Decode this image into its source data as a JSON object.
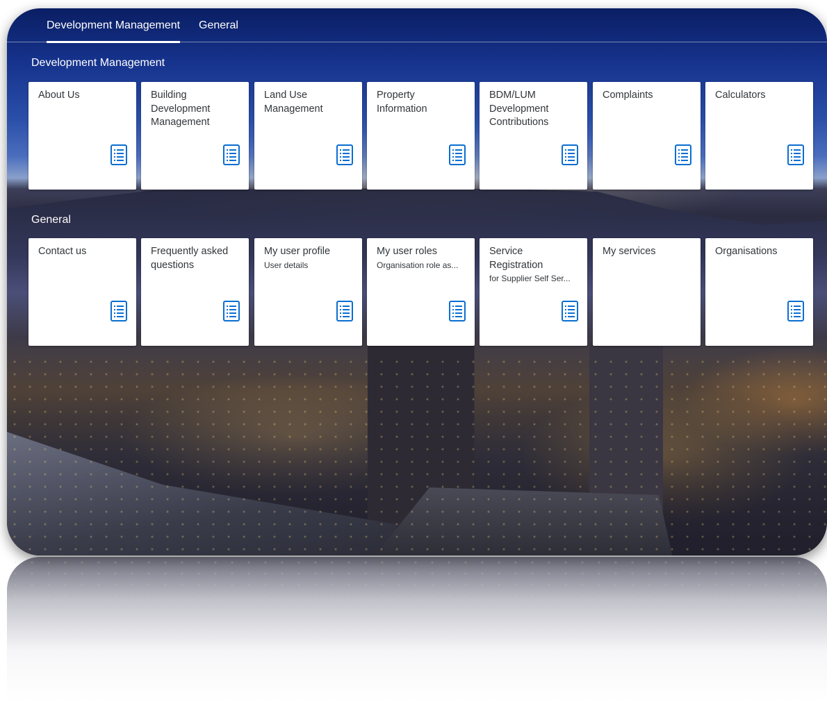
{
  "tabs": [
    {
      "label": "Development Management",
      "active": true
    },
    {
      "label": "General",
      "active": false
    }
  ],
  "sections": [
    {
      "title": "Development Management",
      "tiles": [
        {
          "title": "About Us",
          "subtitle": "",
          "icon": "list-icon"
        },
        {
          "title": "Building Development Management",
          "subtitle": "",
          "icon": "list-icon"
        },
        {
          "title": "Land Use Management",
          "subtitle": "",
          "icon": "list-icon"
        },
        {
          "title": "Property Information",
          "subtitle": "",
          "icon": "list-icon"
        },
        {
          "title": "BDM/LUM Development Contributions",
          "subtitle": "",
          "icon": "list-icon"
        },
        {
          "title": "Complaints",
          "subtitle": "",
          "icon": "list-icon"
        },
        {
          "title": "Calculators",
          "subtitle": "",
          "icon": "list-icon"
        }
      ]
    },
    {
      "title": "General",
      "tiles": [
        {
          "title": "Contact us",
          "subtitle": "",
          "icon": "list-icon"
        },
        {
          "title": "Frequently asked questions",
          "subtitle": "",
          "icon": "list-icon"
        },
        {
          "title": "My user profile",
          "subtitle": "User details",
          "icon": "list-icon"
        },
        {
          "title": "My user roles",
          "subtitle": "Organisation role as...",
          "icon": "list-icon"
        },
        {
          "title": "Service Registration",
          "subtitle": "for Supplier Self Ser...",
          "icon": "list-icon"
        },
        {
          "title": "My services",
          "subtitle": "",
          "icon": ""
        },
        {
          "title": "Organisations",
          "subtitle": "",
          "icon": "list-icon"
        }
      ]
    }
  ],
  "colors": {
    "tile_bg": "#ffffff",
    "tile_text": "#32363a",
    "icon_accent": "#0a6ed1",
    "header_text": "#ffffff"
  }
}
